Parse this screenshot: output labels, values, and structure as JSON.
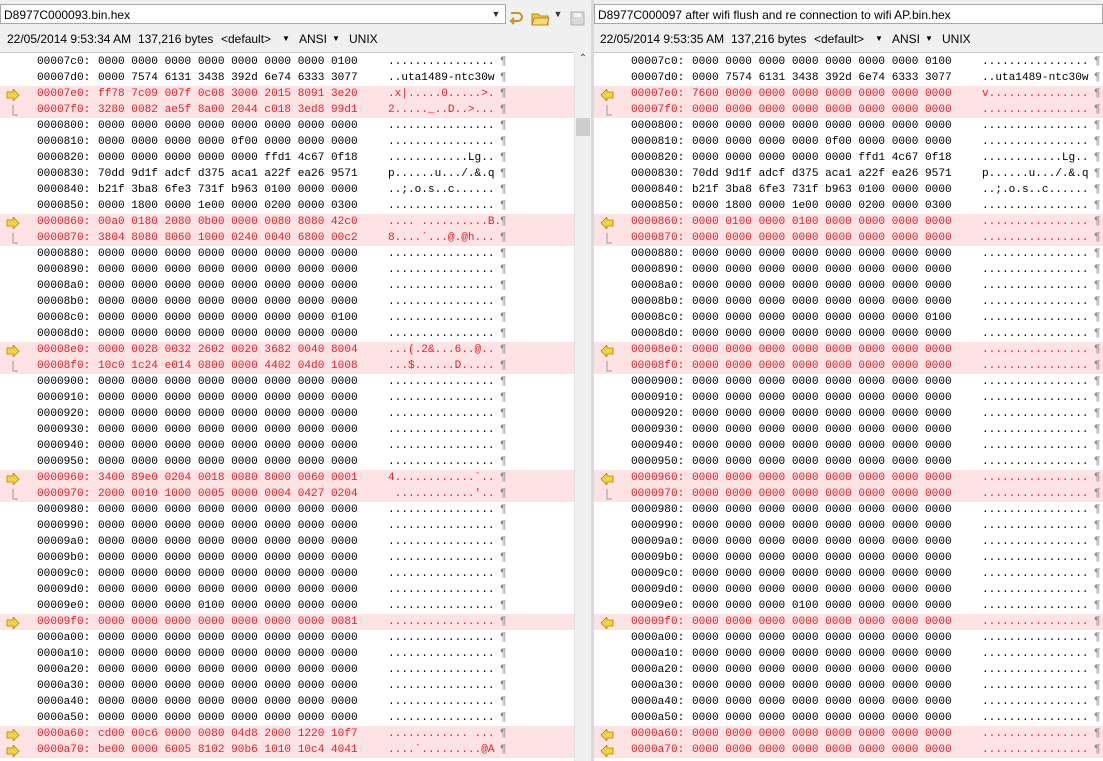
{
  "left": {
    "path": "D8977C000093.bin.hex",
    "date": "22/05/2014 9:53:34 AM",
    "size": "137,216 bytes",
    "encoding_default": "<default>",
    "charset": "ANSI",
    "eol": "UNIX"
  },
  "right": {
    "path": "D8977C000097 after wifi flush and re connection to wifi AP.bin.hex",
    "date": "22/05/2014 9:53:35 AM",
    "size": "137,216 bytes",
    "encoding_default": "<default>",
    "charset": "ANSI",
    "eol": "UNIX"
  },
  "pilcrow": "¶",
  "left_lines": [
    {
      "addr": "00007c0:",
      "hex": "0000 0000 0000 0000 0000 0000 0000 0100",
      "ascii": "................",
      "diff": false,
      "marker": ""
    },
    {
      "addr": "00007d0:",
      "hex": "0000 7574 6131 3438 392d 6e74 6333 3077",
      "ascii": "..uta1489-ntc30w",
      "diff": false,
      "marker": ""
    },
    {
      "addr": "00007e0:",
      "hex": "ff78 7c09 007f 0c08 3000 2015 8091 3e20",
      "ascii": ".x|.....0.....>.",
      "diff": true,
      "marker": "arrow"
    },
    {
      "addr": "00007f0:",
      "hex": "3280 0082 ae5f 8a00 2044 c018 3ed8 99d1",
      "ascii": "2....._..D..>...",
      "diff": true,
      "marker": "bracket"
    },
    {
      "addr": "0000800:",
      "hex": "0000 0000 0000 0000 0000 0000 0000 0000",
      "ascii": "................",
      "diff": false,
      "marker": ""
    },
    {
      "addr": "0000810:",
      "hex": "0000 0000 0000 0000 0f00 0000 0000 0000",
      "ascii": "................",
      "diff": false,
      "marker": ""
    },
    {
      "addr": "0000820:",
      "hex": "0000 0000 0000 0000 0000 ffd1 4c67 0f18",
      "ascii": "............Lg..",
      "diff": false,
      "marker": ""
    },
    {
      "addr": "0000830:",
      "hex": "70dd 9d1f adcf d375 aca1 a22f ea26 9571",
      "ascii": "p......u.../.&.q",
      "diff": false,
      "marker": ""
    },
    {
      "addr": "0000840:",
      "hex": "b21f 3ba8 6fe3 731f b963 0100 0000 0000",
      "ascii": "..;.o.s..c......",
      "diff": false,
      "marker": ""
    },
    {
      "addr": "0000850:",
      "hex": "0000 1800 0000 1e00 0000 0200 0000 0300",
      "ascii": "................",
      "diff": false,
      "marker": ""
    },
    {
      "addr": "0000860:",
      "hex": "00a0 0180 2080 0b00 0000 0080 8080 42c0",
      "ascii": ".... ..........B.",
      "diff": true,
      "marker": "arrow"
    },
    {
      "addr": "0000870:",
      "hex": "3804 8080 8060 1000 0240 0040 6800 00c2",
      "ascii": "8....`...@.@h...",
      "diff": true,
      "marker": "bracket"
    },
    {
      "addr": "0000880:",
      "hex": "0000 0000 0000 0000 0000 0000 0000 0000",
      "ascii": "................",
      "diff": false,
      "marker": ""
    },
    {
      "addr": "0000890:",
      "hex": "0000 0000 0000 0000 0000 0000 0000 0000",
      "ascii": "................",
      "diff": false,
      "marker": ""
    },
    {
      "addr": "00008a0:",
      "hex": "0000 0000 0000 0000 0000 0000 0000 0000",
      "ascii": "................",
      "diff": false,
      "marker": ""
    },
    {
      "addr": "00008b0:",
      "hex": "0000 0000 0000 0000 0000 0000 0000 0000",
      "ascii": "................",
      "diff": false,
      "marker": ""
    },
    {
      "addr": "00008c0:",
      "hex": "0000 0000 0000 0000 0000 0000 0000 0100",
      "ascii": "................",
      "diff": false,
      "marker": ""
    },
    {
      "addr": "00008d0:",
      "hex": "0000 0000 0000 0000 0000 0000 0000 0000",
      "ascii": "................",
      "diff": false,
      "marker": ""
    },
    {
      "addr": "00008e0:",
      "hex": "0000 0028 0032 2602 0020 3682 0040 8004",
      "ascii": "...(.2&...6..@..",
      "diff": true,
      "marker": "arrow"
    },
    {
      "addr": "00008f0:",
      "hex": "10c0 1c24 e014 0800 0000 4402 04d0 1008",
      "ascii": "...$......D.....",
      "diff": true,
      "marker": "bracket"
    },
    {
      "addr": "0000900:",
      "hex": "0000 0000 0000 0000 0000 0000 0000 0000",
      "ascii": "................",
      "diff": false,
      "marker": ""
    },
    {
      "addr": "0000910:",
      "hex": "0000 0000 0000 0000 0000 0000 0000 0000",
      "ascii": "................",
      "diff": false,
      "marker": ""
    },
    {
      "addr": "0000920:",
      "hex": "0000 0000 0000 0000 0000 0000 0000 0000",
      "ascii": "................",
      "diff": false,
      "marker": ""
    },
    {
      "addr": "0000930:",
      "hex": "0000 0000 0000 0000 0000 0000 0000 0000",
      "ascii": "................",
      "diff": false,
      "marker": ""
    },
    {
      "addr": "0000940:",
      "hex": "0000 0000 0000 0000 0000 0000 0000 0000",
      "ascii": "................",
      "diff": false,
      "marker": ""
    },
    {
      "addr": "0000950:",
      "hex": "0000 0000 0000 0000 0000 0000 0000 0000",
      "ascii": "................",
      "diff": false,
      "marker": ""
    },
    {
      "addr": "0000960:",
      "hex": "3400 89e0 0204 0018 0080 8000 0060 0001",
      "ascii": "4............`..",
      "diff": true,
      "marker": "arrow"
    },
    {
      "addr": "0000970:",
      "hex": "2000 0010 1000 0005 0000 0004 0427 0204",
      "ascii": " ............'..",
      "diff": true,
      "marker": "bracket"
    },
    {
      "addr": "0000980:",
      "hex": "0000 0000 0000 0000 0000 0000 0000 0000",
      "ascii": "................",
      "diff": false,
      "marker": ""
    },
    {
      "addr": "0000990:",
      "hex": "0000 0000 0000 0000 0000 0000 0000 0000",
      "ascii": "................",
      "diff": false,
      "marker": ""
    },
    {
      "addr": "00009a0:",
      "hex": "0000 0000 0000 0000 0000 0000 0000 0000",
      "ascii": "................",
      "diff": false,
      "marker": ""
    },
    {
      "addr": "00009b0:",
      "hex": "0000 0000 0000 0000 0000 0000 0000 0000",
      "ascii": "................",
      "diff": false,
      "marker": ""
    },
    {
      "addr": "00009c0:",
      "hex": "0000 0000 0000 0000 0000 0000 0000 0000",
      "ascii": "................",
      "diff": false,
      "marker": ""
    },
    {
      "addr": "00009d0:",
      "hex": "0000 0000 0000 0000 0000 0000 0000 0000",
      "ascii": "................",
      "diff": false,
      "marker": ""
    },
    {
      "addr": "00009e0:",
      "hex": "0000 0000 0000 0100 0000 0000 0000 0000",
      "ascii": "................",
      "diff": false,
      "marker": ""
    },
    {
      "addr": "00009f0:",
      "hex": "0000 0000 0000 0000 0000 0000 0000 0081",
      "ascii": "................",
      "diff": true,
      "marker": "arrow"
    },
    {
      "addr": "0000a00:",
      "hex": "0000 0000 0000 0000 0000 0000 0000 0000",
      "ascii": "................",
      "diff": false,
      "marker": ""
    },
    {
      "addr": "0000a10:",
      "hex": "0000 0000 0000 0000 0000 0000 0000 0000",
      "ascii": "................",
      "diff": false,
      "marker": ""
    },
    {
      "addr": "0000a20:",
      "hex": "0000 0000 0000 0000 0000 0000 0000 0000",
      "ascii": "................",
      "diff": false,
      "marker": ""
    },
    {
      "addr": "0000a30:",
      "hex": "0000 0000 0000 0000 0000 0000 0000 0000",
      "ascii": "................",
      "diff": false,
      "marker": ""
    },
    {
      "addr": "0000a40:",
      "hex": "0000 0000 0000 0000 0000 0000 0000 0000",
      "ascii": "................",
      "diff": false,
      "marker": ""
    },
    {
      "addr": "0000a50:",
      "hex": "0000 0000 0000 0000 0000 0000 0000 0000",
      "ascii": "................",
      "diff": false,
      "marker": ""
    },
    {
      "addr": "0000a60:",
      "hex": "cd00 00c6 0000 0080 04d8 2000 1220 10f7",
      "ascii": "............ ...",
      "diff": true,
      "marker": "arrow"
    },
    {
      "addr": "0000a70:",
      "hex": "be00 0000 6005 8102 90b6 1010 10c4 4041",
      "ascii": "....`.........@A",
      "diff": true,
      "marker": "arrow"
    }
  ],
  "right_lines": [
    {
      "addr": "00007c0:",
      "hex": "0000 0000 0000 0000 0000 0000 0000 0100",
      "ascii": "................",
      "diff": false,
      "marker": ""
    },
    {
      "addr": "00007d0:",
      "hex": "0000 7574 6131 3438 392d 6e74 6333 3077",
      "ascii": "..uta1489-ntc30w",
      "diff": false,
      "marker": ""
    },
    {
      "addr": "00007e0:",
      "hex": "7600 0000 0000 0000 0000 0000 0000 0000",
      "ascii": "v...............",
      "diff": true,
      "marker": "arrow"
    },
    {
      "addr": "00007f0:",
      "hex": "0000 0000 0000 0000 0000 0000 0000 0000",
      "ascii": "................",
      "diff": true,
      "marker": "bracket"
    },
    {
      "addr": "0000800:",
      "hex": "0000 0000 0000 0000 0000 0000 0000 0000",
      "ascii": "................",
      "diff": false,
      "marker": ""
    },
    {
      "addr": "0000810:",
      "hex": "0000 0000 0000 0000 0f00 0000 0000 0000",
      "ascii": "................",
      "diff": false,
      "marker": ""
    },
    {
      "addr": "0000820:",
      "hex": "0000 0000 0000 0000 0000 ffd1 4c67 0f18",
      "ascii": "............Lg..",
      "diff": false,
      "marker": ""
    },
    {
      "addr": "0000830:",
      "hex": "70dd 9d1f adcf d375 aca1 a22f ea26 9571",
      "ascii": "p......u.../.&.q",
      "diff": false,
      "marker": ""
    },
    {
      "addr": "0000840:",
      "hex": "b21f 3ba8 6fe3 731f b963 0100 0000 0000",
      "ascii": "..;.o.s..c......",
      "diff": false,
      "marker": ""
    },
    {
      "addr": "0000850:",
      "hex": "0000 1800 0000 1e00 0000 0200 0000 0300",
      "ascii": "................",
      "diff": false,
      "marker": ""
    },
    {
      "addr": "0000860:",
      "hex": "0000 0100 0000 0100 0000 0000 0000 0000",
      "ascii": "................",
      "diff": true,
      "marker": "arrow"
    },
    {
      "addr": "0000870:",
      "hex": "0000 0000 0000 0000 0000 0000 0000 0000",
      "ascii": "................",
      "diff": true,
      "marker": "bracket"
    },
    {
      "addr": "0000880:",
      "hex": "0000 0000 0000 0000 0000 0000 0000 0000",
      "ascii": "................",
      "diff": false,
      "marker": ""
    },
    {
      "addr": "0000890:",
      "hex": "0000 0000 0000 0000 0000 0000 0000 0000",
      "ascii": "................",
      "diff": false,
      "marker": ""
    },
    {
      "addr": "00008a0:",
      "hex": "0000 0000 0000 0000 0000 0000 0000 0000",
      "ascii": "................",
      "diff": false,
      "marker": ""
    },
    {
      "addr": "00008b0:",
      "hex": "0000 0000 0000 0000 0000 0000 0000 0000",
      "ascii": "................",
      "diff": false,
      "marker": ""
    },
    {
      "addr": "00008c0:",
      "hex": "0000 0000 0000 0000 0000 0000 0000 0100",
      "ascii": "................",
      "diff": false,
      "marker": ""
    },
    {
      "addr": "00008d0:",
      "hex": "0000 0000 0000 0000 0000 0000 0000 0000",
      "ascii": "................",
      "diff": false,
      "marker": ""
    },
    {
      "addr": "00008e0:",
      "hex": "0000 0000 0000 0000 0000 0000 0000 0000",
      "ascii": "................",
      "diff": true,
      "marker": "arrow"
    },
    {
      "addr": "00008f0:",
      "hex": "0000 0000 0000 0000 0000 0000 0000 0000",
      "ascii": "................",
      "diff": true,
      "marker": "bracket"
    },
    {
      "addr": "0000900:",
      "hex": "0000 0000 0000 0000 0000 0000 0000 0000",
      "ascii": "................",
      "diff": false,
      "marker": ""
    },
    {
      "addr": "0000910:",
      "hex": "0000 0000 0000 0000 0000 0000 0000 0000",
      "ascii": "................",
      "diff": false,
      "marker": ""
    },
    {
      "addr": "0000920:",
      "hex": "0000 0000 0000 0000 0000 0000 0000 0000",
      "ascii": "................",
      "diff": false,
      "marker": ""
    },
    {
      "addr": "0000930:",
      "hex": "0000 0000 0000 0000 0000 0000 0000 0000",
      "ascii": "................",
      "diff": false,
      "marker": ""
    },
    {
      "addr": "0000940:",
      "hex": "0000 0000 0000 0000 0000 0000 0000 0000",
      "ascii": "................",
      "diff": false,
      "marker": ""
    },
    {
      "addr": "0000950:",
      "hex": "0000 0000 0000 0000 0000 0000 0000 0000",
      "ascii": "................",
      "diff": false,
      "marker": ""
    },
    {
      "addr": "0000960:",
      "hex": "0000 0000 0000 0000 0000 0000 0000 0000",
      "ascii": "................",
      "diff": true,
      "marker": "arrow"
    },
    {
      "addr": "0000970:",
      "hex": "0000 0000 0000 0000 0000 0000 0000 0000",
      "ascii": "................",
      "diff": true,
      "marker": "bracket"
    },
    {
      "addr": "0000980:",
      "hex": "0000 0000 0000 0000 0000 0000 0000 0000",
      "ascii": "................",
      "diff": false,
      "marker": ""
    },
    {
      "addr": "0000990:",
      "hex": "0000 0000 0000 0000 0000 0000 0000 0000",
      "ascii": "................",
      "diff": false,
      "marker": ""
    },
    {
      "addr": "00009a0:",
      "hex": "0000 0000 0000 0000 0000 0000 0000 0000",
      "ascii": "................",
      "diff": false,
      "marker": ""
    },
    {
      "addr": "00009b0:",
      "hex": "0000 0000 0000 0000 0000 0000 0000 0000",
      "ascii": "................",
      "diff": false,
      "marker": ""
    },
    {
      "addr": "00009c0:",
      "hex": "0000 0000 0000 0000 0000 0000 0000 0000",
      "ascii": "................",
      "diff": false,
      "marker": ""
    },
    {
      "addr": "00009d0:",
      "hex": "0000 0000 0000 0000 0000 0000 0000 0000",
      "ascii": "................",
      "diff": false,
      "marker": ""
    },
    {
      "addr": "00009e0:",
      "hex": "0000 0000 0000 0100 0000 0000 0000 0000",
      "ascii": "................",
      "diff": false,
      "marker": ""
    },
    {
      "addr": "00009f0:",
      "hex": "0000 0000 0000 0000 0000 0000 0000 0000",
      "ascii": "................",
      "diff": true,
      "marker": "arrow"
    },
    {
      "addr": "0000a00:",
      "hex": "0000 0000 0000 0000 0000 0000 0000 0000",
      "ascii": "................",
      "diff": false,
      "marker": ""
    },
    {
      "addr": "0000a10:",
      "hex": "0000 0000 0000 0000 0000 0000 0000 0000",
      "ascii": "................",
      "diff": false,
      "marker": ""
    },
    {
      "addr": "0000a20:",
      "hex": "0000 0000 0000 0000 0000 0000 0000 0000",
      "ascii": "................",
      "diff": false,
      "marker": ""
    },
    {
      "addr": "0000a30:",
      "hex": "0000 0000 0000 0000 0000 0000 0000 0000",
      "ascii": "................",
      "diff": false,
      "marker": ""
    },
    {
      "addr": "0000a40:",
      "hex": "0000 0000 0000 0000 0000 0000 0000 0000",
      "ascii": "................",
      "diff": false,
      "marker": ""
    },
    {
      "addr": "0000a50:",
      "hex": "0000 0000 0000 0000 0000 0000 0000 0000",
      "ascii": "................",
      "diff": false,
      "marker": ""
    },
    {
      "addr": "0000a60:",
      "hex": "0000 0000 0000 0000 0000 0000 0000 0000",
      "ascii": "................",
      "diff": true,
      "marker": "arrow"
    },
    {
      "addr": "0000a70:",
      "hex": "0000 0000 0000 0000 0000 0000 0000 0000",
      "ascii": "................",
      "diff": true,
      "marker": "arrow"
    }
  ]
}
